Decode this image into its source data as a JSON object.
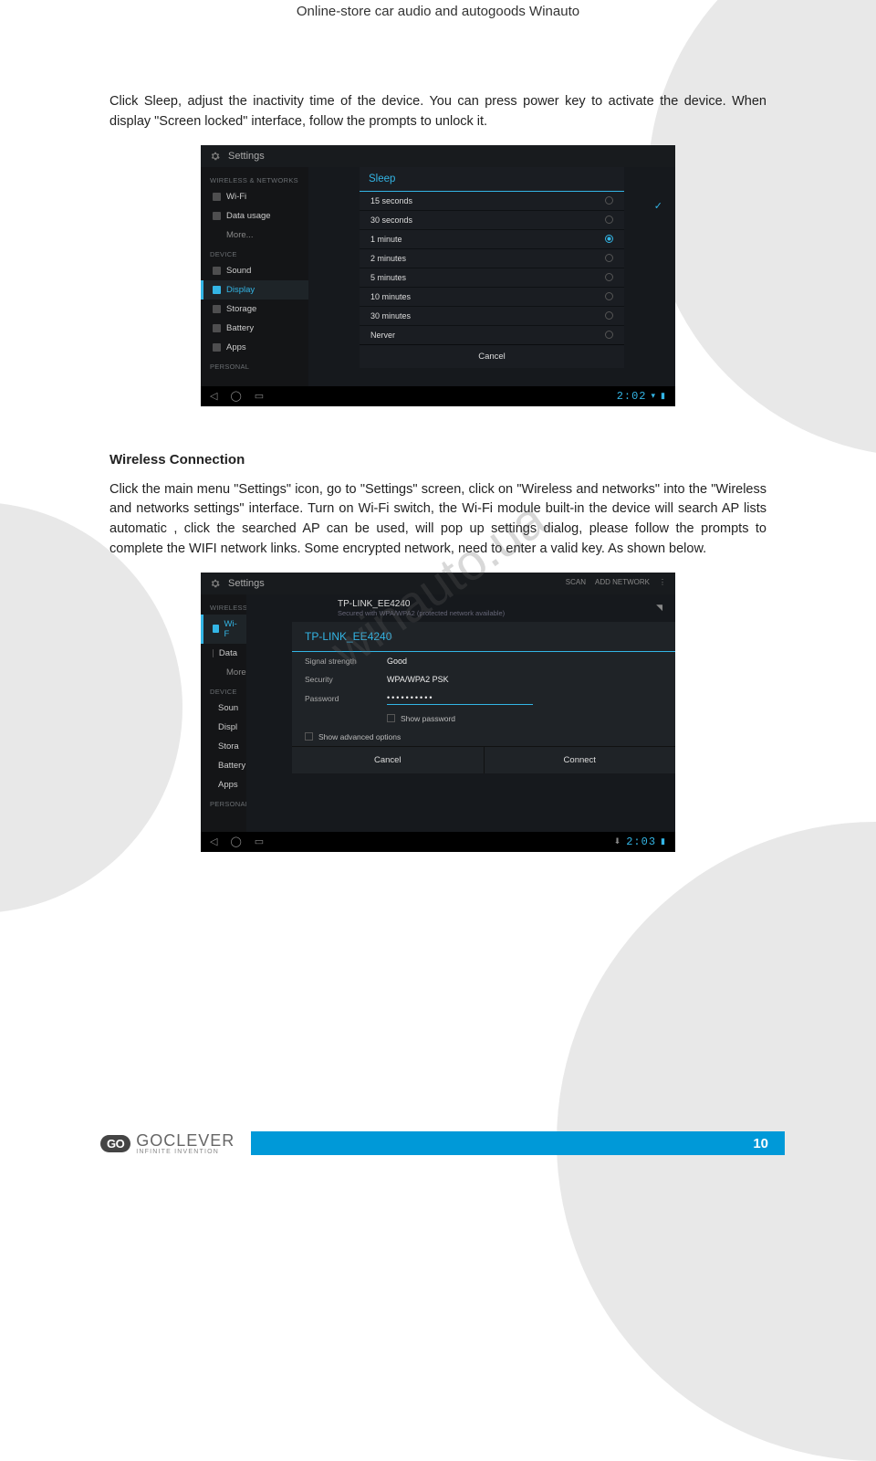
{
  "header": "Online-store car audio and autogoods Winauto",
  "watermark": "winauto.ua",
  "para1": "Click Sleep, adjust the inactivity time of the device. You can press power key to activate the device. When display \"Screen locked\" interface, follow the prompts to unlock it.",
  "screenshot1": {
    "title": "Settings",
    "sidebar": {
      "section1": "WIRELESS & NETWORKS",
      "items1": [
        "Wi-Fi",
        "Data usage",
        "More..."
      ],
      "section2": "DEVICE",
      "items2": [
        "Sound",
        "Display",
        "Storage",
        "Battery",
        "Apps"
      ],
      "section3": "PERSONAL"
    },
    "dialog": {
      "title": "Sleep",
      "options": [
        "15 seconds",
        "30 seconds",
        "1 minute",
        "2 minutes",
        "5 minutes",
        "10 minutes",
        "30 minutes",
        "Nerver"
      ],
      "selected_index": 2,
      "cancel": "Cancel"
    },
    "time": "2:02"
  },
  "heading2": "Wireless Connection",
  "para2": "Click the main menu \"Settings\" icon, go to \"Settings\" screen, click on \"Wireless and networks\" into the \"Wireless and networks settings\" interface. Turn on Wi-Fi  switch, the Wi-Fi  module built-in the device will search AP lists automatic , click the searched AP can be used, will pop up settings dialog, please follow the prompts to complete the WIFI network links. Some encrypted network, need to enter a valid key. As shown below.",
  "screenshot2": {
    "title": "Settings",
    "topbar": {
      "scan": "SCAN",
      "add": "ADD NETWORK"
    },
    "network": {
      "ssid": "TP-LINK_EE4240",
      "sub": "Secured with WPA/WPA2 (protected network available)"
    },
    "sidebar": {
      "section1": "WIRELESS & NETWORKS",
      "items1_trunc": [
        "Wi-F",
        "Data",
        "More"
      ],
      "section2": "DEVICE",
      "items2_trunc": [
        "Soun",
        "Displ",
        "Stora",
        "Battery",
        "Apps"
      ],
      "section3": "PERSONAL"
    },
    "dialog": {
      "title": "TP-LINK_EE4240",
      "fields": {
        "signal_label": "Signal strength",
        "signal_value": "Good",
        "security_label": "Security",
        "security_value": "WPA/WPA2 PSK",
        "password_label": "Password",
        "password_value": "••••••••••"
      },
      "show_password": "Show password",
      "advanced": "Show advanced options",
      "cancel": "Cancel",
      "connect": "Connect"
    },
    "time": "2:03"
  },
  "footer": {
    "brand_badge": "GO",
    "brand": "GOCLEVER",
    "tagline": "INFINITE INVENTION",
    "page_number": "10"
  }
}
